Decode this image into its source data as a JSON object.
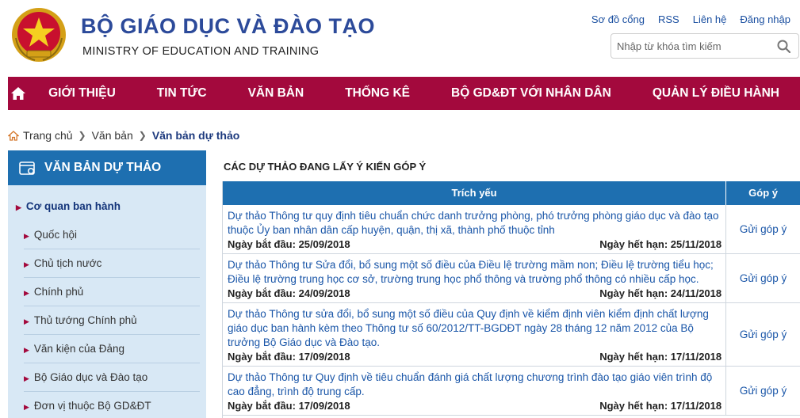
{
  "header": {
    "ministry_vn": "BỘ GIÁO DỤC VÀ ĐÀO TẠO",
    "ministry_en": "MINISTRY OF EDUCATION AND TRAINING",
    "top_links": [
      "Sơ đồ cổng",
      "RSS",
      "Liên hệ",
      "Đăng nhập"
    ],
    "search_placeholder": "Nhập từ khóa tìm kiếm"
  },
  "nav": {
    "home_icon": "home-icon",
    "items": [
      "GIỚI THIỆU",
      "TIN TỨC",
      "VĂN BẢN",
      "THỐNG KÊ",
      "BỘ GD&ĐT VỚI NHÂN DÂN",
      "QUẢN LÝ ĐIỀU HÀNH"
    ]
  },
  "breadcrumb": {
    "home": "Trang chủ",
    "level1": "Văn bản",
    "current": "Văn bản dự thảo"
  },
  "sidebar": {
    "title": "VĂN BẢN DỰ THẢO",
    "group": "Cơ quan ban hành",
    "items": [
      "Quốc hội",
      "Chủ tịch nước",
      "Chính phủ",
      "Thủ tướng Chính phủ",
      "Văn kiện của Đảng",
      "Bộ Giáo dục và Đào tạo",
      "Đơn vị thuộc Bộ GD&ĐT"
    ]
  },
  "main": {
    "title": "CÁC DỰ THẢO ĐANG LẤY Ý KIẾN GÓP Ý",
    "col_summary": "Trích yếu",
    "col_action": "Góp ý",
    "rows": [
      {
        "desc": "Dự thảo Thông tư quy định tiêu chuẩn chức danh trưởng phòng, phó trưởng phòng giáo dục và đào tạo thuộc Ủy ban nhân dân cấp huyện, quận, thị xã, thành phố thuộc tỉnh",
        "start": "Ngày bắt đầu: 25/09/2018",
        "end": "Ngày hết hạn: 25/11/2018",
        "action": "Gửi góp ý"
      },
      {
        "desc": "Dự thảo Thông tư Sửa đổi, bổ sung một số điều của Điều lệ trường mầm non; Điều lệ trường tiểu học; Điều lệ trường trung học cơ sở, trường trung học phổ thông và trường phổ thông có nhiều cấp học.",
        "start": "Ngày bắt đầu: 24/09/2018",
        "end": "Ngày hết hạn: 24/11/2018",
        "action": "Gửi góp ý"
      },
      {
        "desc": "Dự thảo Thông tư sửa đổi, bổ sung một số điều của Quy định về kiểm định viên kiểm định chất lượng giáo dục ban hành kèm theo Thông tư số 60/2012/TT-BGDĐT ngày 28 tháng 12 năm 2012 của Bộ trưởng Bộ Giáo dục và Đào tạo.",
        "start": "Ngày bắt đầu: 17/09/2018",
        "end": "Ngày hết hạn: 17/11/2018",
        "action": "Gửi góp ý"
      },
      {
        "desc": "Dự thảo Thông tư Quy định về tiêu chuẩn đánh giá chất lượng chương trình đào tạo giáo viên trình độ cao đẳng, trình độ trung cấp.",
        "start": "Ngày bắt đầu: 17/09/2018",
        "end": "Ngày hết hạn: 17/11/2018",
        "action": "Gửi góp ý"
      }
    ]
  },
  "colors": {
    "nav_bg": "#a3093d",
    "sidebar_head": "#1e6fb0",
    "sidebar_bg": "#d8e8f5",
    "link": "#1a56a8",
    "brand_blue": "#2c4a9a"
  }
}
